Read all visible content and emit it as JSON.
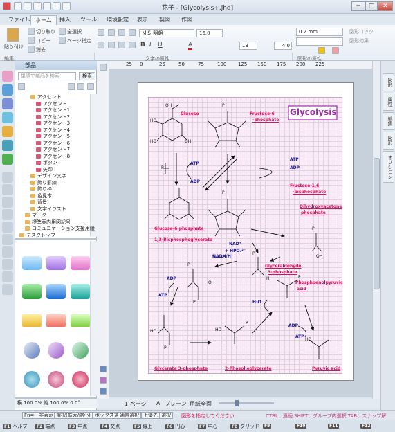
{
  "window": {
    "title": "花子 - [Glycolysis+.jhd]",
    "min": "─",
    "max": "□",
    "close": "✕"
  },
  "tabs": [
    "ファイル",
    "ホーム",
    "挿入",
    "ツール",
    "環境設定",
    "表示",
    "製図",
    "作図"
  ],
  "ribbon": {
    "paste": "貼り付け",
    "cut": "切り取り",
    "copy": "コピー",
    "delete": "消去",
    "select_all": "全選択",
    "page_spec": "ページ指定",
    "font_name": "ＭＳ 明朝",
    "font_size": "16.0",
    "char_spacing": "13",
    "char_size": "4.0",
    "line_width": "0.2 mm",
    "shape_lock": "図形ロック",
    "shape_effect": "図形効果",
    "group_edit": "編集",
    "group_font": "文字の属性",
    "group_shape": "図形の属性"
  },
  "panel": {
    "title": "部品",
    "search_placeholder": "単語で部品を検索",
    "search_button": "検索",
    "tree": [
      {
        "label": "アクセント",
        "indent": 2,
        "folder": true
      },
      {
        "label": "アクセント",
        "indent": 3
      },
      {
        "label": "アクセント1",
        "indent": 3
      },
      {
        "label": "アクセント2",
        "indent": 3
      },
      {
        "label": "アクセント3",
        "indent": 3
      },
      {
        "label": "アクセント4",
        "indent": 3
      },
      {
        "label": "アクセント5",
        "indent": 3
      },
      {
        "label": "アクセント6",
        "indent": 3
      },
      {
        "label": "アクセント7",
        "indent": 3
      },
      {
        "label": "アクセント8",
        "indent": 3
      },
      {
        "label": "ボタン",
        "indent": 3
      },
      {
        "label": "矢印",
        "indent": 3
      },
      {
        "label": "デザイン文字",
        "indent": 2,
        "folder": true
      },
      {
        "label": "飾り罫線",
        "indent": 2,
        "folder": true
      },
      {
        "label": "飾り枠",
        "indent": 2,
        "folder": true
      },
      {
        "label": "色見本",
        "indent": 2,
        "folder": true
      },
      {
        "label": "背景",
        "indent": 2,
        "folder": true
      },
      {
        "label": "文字イラスト",
        "indent": 2,
        "folder": true
      },
      {
        "label": "マーク",
        "indent": 1,
        "folder": true
      },
      {
        "label": "標準案内用図記号",
        "indent": 1,
        "folder": true
      },
      {
        "label": "コミュニケーション支援用絵",
        "indent": 1,
        "folder": true
      },
      {
        "label": "デスクトップ",
        "indent": 0,
        "folder": true
      }
    ],
    "dock_text": "横 100.0% 縦 100.0%    0.0°"
  },
  "diagram": {
    "title": "Glycolysis",
    "labels": {
      "glucose": "Glucose",
      "f6p_1": "Fructose-6",
      "f6p_2": "-phosphate",
      "f16bp_1": "Fructose-1,6",
      "f16bp_2": "-bisphosphate",
      "g6p": "Glucose-6-phosphate",
      "dhap_1": "Dihydroxyacetone",
      "dhap_2": "phosphate",
      "bpg13": "1,3-Bisphosphoglycerate",
      "g3p_1": "Glyceraldehyde",
      "g3p_2": "3-phosphate",
      "pep_1": "Phosphoenolpyruvic",
      "pep_2": "acid",
      "glyc3p": "Glycerate 3-phosphate",
      "pg2": "2-Phosphoglycerate",
      "pyruvic": "Pyruvic  acid"
    },
    "cofactors": {
      "atp": "ATP",
      "adp": "ADP",
      "nad": "NAD⁺",
      "hpo4": "+ HPO₄²⁻",
      "nadh": "NADH/H⁺",
      "h2o": "H₂O"
    },
    "atoms": {
      "o": "O",
      "oh": "OH",
      "ho": "HO",
      "p": "P",
      "h": "H"
    }
  },
  "canvas": {
    "page_nav": "1 ページ",
    "layer": "A",
    "layer_label": "プレーン",
    "zoom_label": "用紙全面"
  },
  "ruler": {
    "h": [
      "25",
      "0",
      "25",
      "50",
      "75",
      "100",
      "125",
      "150",
      "175",
      "200",
      "225"
    ]
  },
  "right_tabs": [
    "図形",
    "属性",
    "編集",
    "図形",
    "オプション"
  ],
  "status": {
    "buttons": [
      "Fn=一非表示",
      "選択(拡大/縮小)",
      "ボックス選",
      "通常選択",
      "上優先",
      "選択"
    ],
    "prompt": "図形を指定してください",
    "hint": "CTRL：連続 SHIFT：グループ内選択 TAB：スナップ解"
  },
  "fkeys": [
    {
      "key": "F1",
      "label": "ヘルプ"
    },
    {
      "key": "F2",
      "label": "端点"
    },
    {
      "key": "F3",
      "label": "中点"
    },
    {
      "key": "F4",
      "label": "交点"
    },
    {
      "key": "F5",
      "label": "線上"
    },
    {
      "key": "F6",
      "label": "円心"
    },
    {
      "key": "F7",
      "label": "中心"
    },
    {
      "key": "F8",
      "label": "グリッド"
    },
    {
      "key": "F9",
      "label": ""
    },
    {
      "key": "F10",
      "label": ""
    },
    {
      "key": "F11",
      "label": ""
    },
    {
      "key": "F12",
      "label": ""
    }
  ],
  "colors": {
    "accent": "#d4145a",
    "title_box": "#9b2ca8",
    "cofactor": "#1a1a9c"
  }
}
